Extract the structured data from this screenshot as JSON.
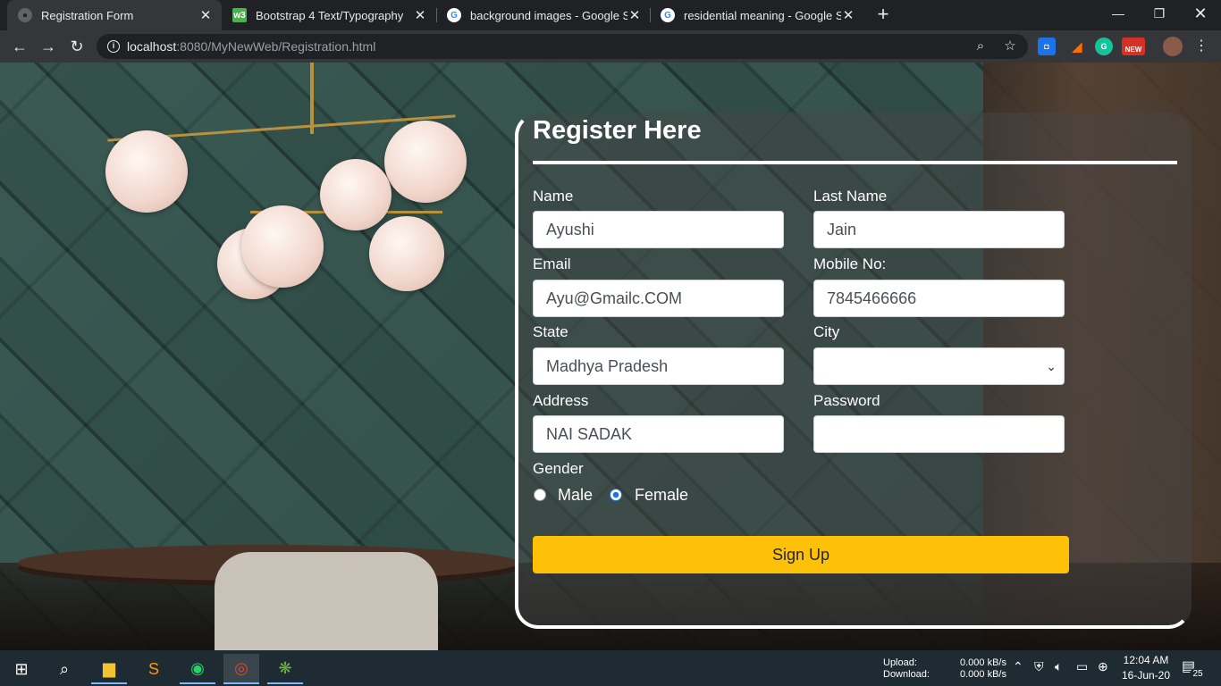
{
  "tabs": [
    {
      "title": "Registration Form",
      "active": true
    },
    {
      "title": "Bootstrap 4 Text/Typography",
      "active": false
    },
    {
      "title": "background images - Google Sea",
      "active": false
    },
    {
      "title": "residential meaning - Google Sea",
      "active": false
    }
  ],
  "address_bar": {
    "host": "localhost",
    "rest": ":8080/MyNewWeb/Registration.html"
  },
  "extensions": {
    "new_badge": "NEW"
  },
  "form": {
    "heading": "Register Here",
    "name_label": "Name",
    "name_value": "Ayushi",
    "last_name_label": "Last Name",
    "last_name_value": "Jain",
    "email_label": "Email",
    "email_value": "Ayu@Gmailc.COM",
    "mobile_label": "Mobile No:",
    "mobile_value": "7845466666",
    "state_label": "State",
    "state_value": "Madhya Pradesh",
    "city_label": "City",
    "city_value": "",
    "address_label": "Address",
    "address_value": "NAI SADAK",
    "password_label": "Password",
    "password_value": "",
    "gender_label": "Gender",
    "gender_options": [
      "Male",
      "Female"
    ],
    "gender_selected": "Female",
    "submit_label": "Sign Up"
  },
  "taskbar": {
    "upload_label": "Upload:",
    "download_label": "Download:",
    "upload_value": "0.000 kB/s",
    "download_value": "0.000 kB/s",
    "time": "12:04 AM",
    "date": "16-Jun-20",
    "notification_count": "25"
  },
  "colors": {
    "accent_button": "#ffc107",
    "radio_selected": "#1a73e8"
  }
}
